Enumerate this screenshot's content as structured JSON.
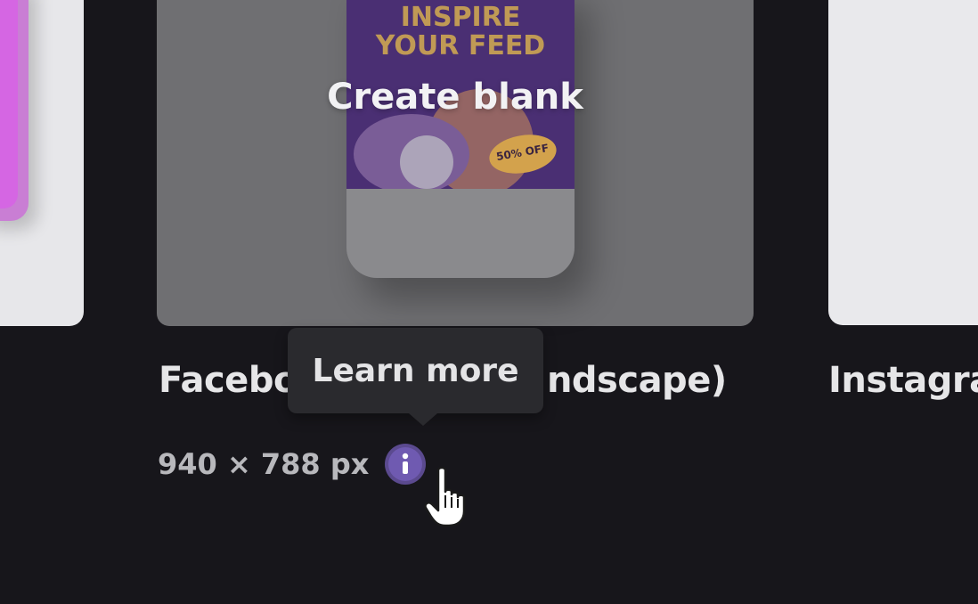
{
  "templates": {
    "center": {
      "hover_action": "Create blank",
      "thumbnail_text_line1": "INSPIRE",
      "thumbnail_text_line2": "YOUR FEED",
      "thumbnail_badge": "50% OFF",
      "title_visible": "Facebo",
      "title_visible_tail": "ndscape)",
      "dimensions": "940 × 788 px"
    },
    "right": {
      "title_visible": "Instagra"
    }
  },
  "tooltip": {
    "text": "Learn more"
  },
  "icons": {
    "info": "info-icon",
    "cursor": "hand-pointer-cursor-icon"
  },
  "colors": {
    "background": "#17161b",
    "card_hover_overlay": "#6f6f72",
    "info_accent": "#6f5ab1",
    "tooltip_bg": "#2a2a2e",
    "left_thumb_accent": "#d566e3"
  }
}
